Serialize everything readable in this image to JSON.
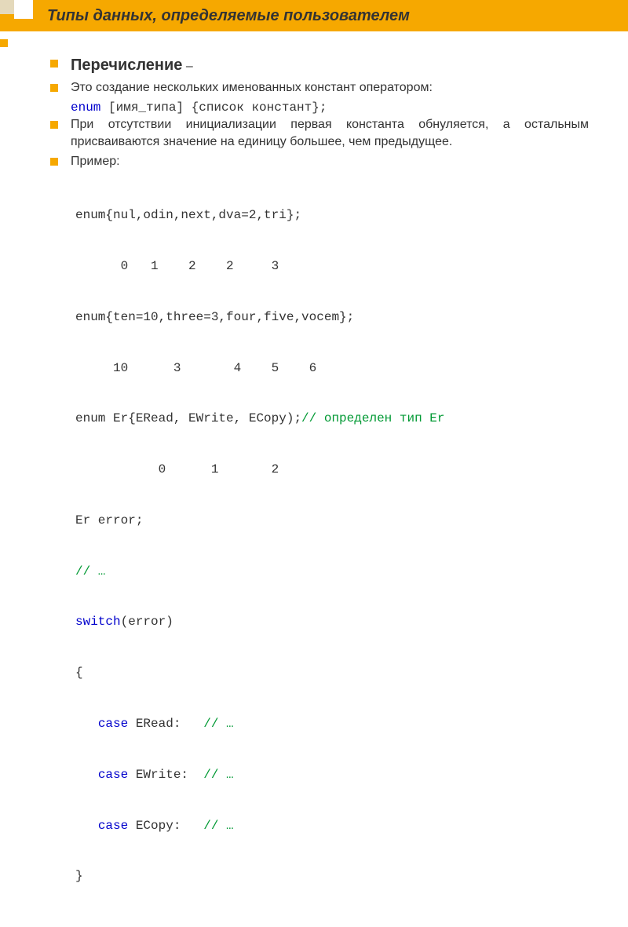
{
  "title": "Типы данных, определяемые пользователем",
  "b1_bold": "Перечисление",
  "b1_suffix": " –",
  "b2": "Это создание нескольких именованных констант оператором:",
  "syntax_kw": "enum",
  "syntax_rest": " [имя_типа] {список констант};",
  "b3": "При отсутствии инициализации первая константа обнуляется, а остальным присваиваются значение на единицу большее, чем предыдущее.",
  "b4": "Пример:",
  "code": {
    "l1": "enum{nul,odin,next,dva=2,tri};",
    "l2": "      0   1    2    2     3",
    "l3": "enum{ten=10,three=3,four,five,vocem};",
    "l4": "     10      3       4    5    6",
    "l5a": "enum Er{ERead, EWrite, ECopy);",
    "l5b": "// определен тип Er",
    "l6": "           0      1       2",
    "l7": "Er error;",
    "l8": "// …",
    "l9a": "switch",
    "l9b": "(error)",
    "l10": "{",
    "l11a": "   ",
    "l11kw": "case",
    "l11b": " ERead:   ",
    "l11c": "// …",
    "l12a": "   ",
    "l12kw": "case",
    "l12b": " EWrite:  ",
    "l12c": "// …",
    "l13a": "   ",
    "l13kw": "case",
    "l13b": " ECopy:   ",
    "l13c": "// …",
    "l14": "}"
  }
}
